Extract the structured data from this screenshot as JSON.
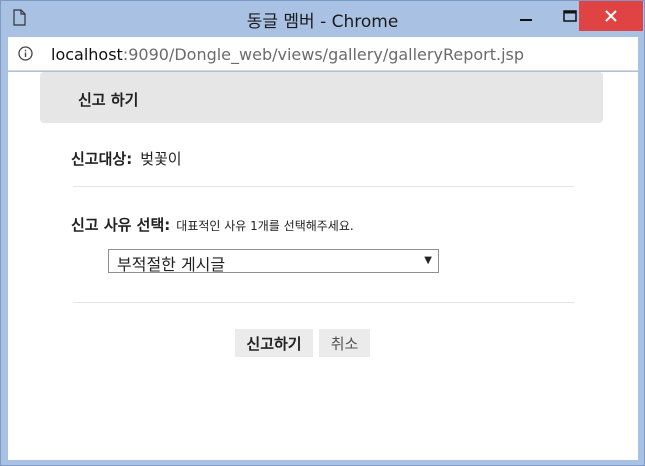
{
  "window": {
    "title": "동글 멤버 - Chrome",
    "colors": {
      "frame": "#a9c2e3",
      "close": "#e04343"
    }
  },
  "address": {
    "host": "localhost",
    "path": ":9090/Dongle_web/views/gallery/galleryReport.jsp"
  },
  "report": {
    "header": "신고 하기",
    "target_label": "신고대상:",
    "target_value": "벚꽃이",
    "reason_label": "신고 사유 선택:",
    "reason_hint": "대표적인 사유 1개를 선택해주세요.",
    "selected_reason": "부적절한 게시글",
    "submit_label": "신고하기",
    "cancel_label": "취소"
  }
}
